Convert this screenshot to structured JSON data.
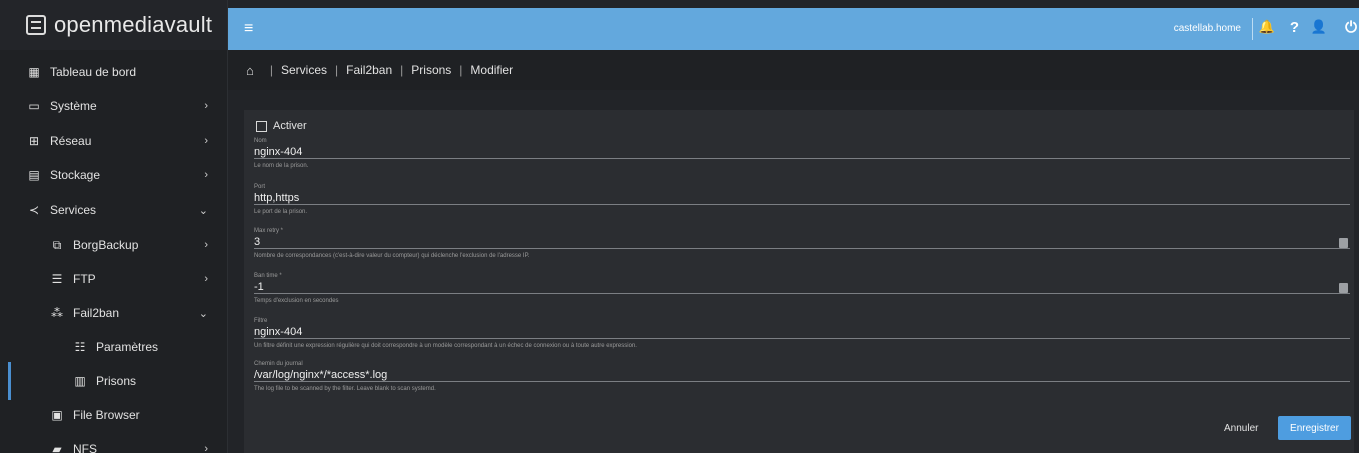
{
  "brand": {
    "name": "openmediavault",
    "logo_icon": "list-icon"
  },
  "sidebar": {
    "items": [
      {
        "label": "Tableau de bord",
        "icon": "grid-icon",
        "glyph": "▦",
        "chevron": ""
      },
      {
        "label": "Système",
        "icon": "laptop-icon",
        "glyph": "▭",
        "chevron": "›"
      },
      {
        "label": "Réseau",
        "icon": "network-icon",
        "glyph": "⊞",
        "chevron": "›"
      },
      {
        "label": "Stockage",
        "icon": "storage-icon",
        "glyph": "▤",
        "chevron": "›"
      },
      {
        "label": "Services",
        "icon": "share-icon",
        "glyph": "≺",
        "chevron": "⌄"
      },
      {
        "label": "BorgBackup",
        "icon": "backup-icon",
        "glyph": "⧉",
        "chevron": "›"
      },
      {
        "label": "FTP",
        "icon": "server-icon",
        "glyph": "☰",
        "chevron": "›"
      },
      {
        "label": "Fail2ban",
        "icon": "sitemap-icon",
        "glyph": "⁂",
        "chevron": "⌄"
      },
      {
        "label": "Paramètres",
        "icon": "settings-sliders-icon",
        "glyph": "☷",
        "chevron": ""
      },
      {
        "label": "Prisons",
        "icon": "jail-icon",
        "glyph": "▥",
        "chevron": ""
      },
      {
        "label": "File Browser",
        "icon": "save-icon",
        "glyph": "▣",
        "chevron": ""
      },
      {
        "label": "NFS",
        "icon": "folder-icon",
        "glyph": "▰",
        "chevron": "›"
      }
    ]
  },
  "topbar": {
    "menu_glyph": "≡",
    "hostname": "castellab.home",
    "bell_glyph": "🔔",
    "help_glyph": "?",
    "user_glyph": "👤",
    "power_glyph": "⏻"
  },
  "breadcrumb": {
    "home_glyph": "⌂",
    "items": [
      "Services",
      "Fail2ban",
      "Prisons",
      "Modifier"
    ]
  },
  "form": {
    "enable_label": "Activer",
    "fields": [
      {
        "label": "Nom",
        "value": "nginx-404",
        "hint": "Le nom de la prison."
      },
      {
        "label": "Port",
        "value": "http,https",
        "hint": "Le port de la prison."
      },
      {
        "label": "Max retry *",
        "value": "3",
        "hint": "Nombre de correspondances (c'est-à-dire valeur du compteur) qui déclenche l'exclusion de l'adresse IP."
      },
      {
        "label": "Ban time *",
        "value": "-1",
        "hint": "Temps d'exclusion en secondes"
      },
      {
        "label": "Filtre",
        "value": "nginx-404",
        "hint": "Un filtre définit une expression régulière qui doit correspondre à un modèle correspondant à un échec de connexion ou à toute autre expression."
      },
      {
        "label": "Chemin du journal",
        "value": "/var/log/nginx*/*access*.log",
        "hint": "The log file to be scanned by the filter. Leave blank to scan systemd."
      }
    ],
    "cancel_label": "Annuler",
    "save_label": "Enregistrer"
  },
  "colors": {
    "accent": "#63a8dd",
    "button": "#4e9de0",
    "background": "#222428"
  }
}
